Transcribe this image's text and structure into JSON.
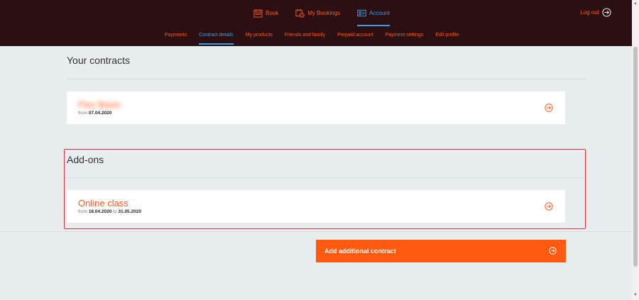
{
  "nav": {
    "items": [
      {
        "label": "Book",
        "icon": "calendar-icon"
      },
      {
        "label": "My Bookings",
        "icon": "calendar-clock-icon"
      },
      {
        "label": "Account",
        "icon": "id-card-icon",
        "active": true
      }
    ],
    "logout": "Log out"
  },
  "subnav": {
    "items": [
      "Payments",
      "Contract details",
      "My products",
      "Friends and family",
      "Prepaid account",
      "Payment settings",
      "Edit profile"
    ],
    "active": "Contract details"
  },
  "contracts": {
    "title": "Your contracts",
    "items": [
      {
        "name": "Flex Basic",
        "from_label": "from",
        "from": "07.04.2020"
      }
    ]
  },
  "addons": {
    "title": "Add-ons",
    "items": [
      {
        "name": "Online class",
        "from_label": "from",
        "from": "16.04.2020",
        "to_label": "to",
        "to": "31.05.2020"
      }
    ]
  },
  "add_button": "Add additional contract",
  "colors": {
    "accent": "#ff5a1f",
    "active": "#3aa0e6",
    "header": "#2b0f12",
    "highlight": "#e0303a"
  }
}
